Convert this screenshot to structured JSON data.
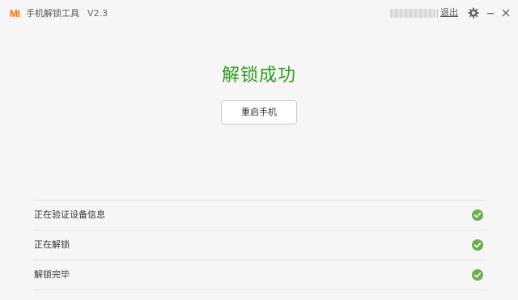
{
  "titlebar": {
    "logo": "MI",
    "title": "手机解锁工具",
    "version": "V2.3",
    "logout_label": "退出"
  },
  "main": {
    "headline": "解锁成功",
    "reboot_button": "重启手机"
  },
  "steps": [
    {
      "label": "正在验证设备信息",
      "status": "done"
    },
    {
      "label": "正在解锁",
      "status": "done"
    },
    {
      "label": "解锁完毕",
      "status": "done"
    }
  ],
  "colors": {
    "brand": "#ff6700",
    "success": "#2e9a1e",
    "check": "#6ab04c",
    "background": "#f6f6f6"
  },
  "icons": [
    "mi-logo",
    "gear-icon",
    "minimize-icon",
    "close-icon",
    "check-circle-icon"
  ]
}
